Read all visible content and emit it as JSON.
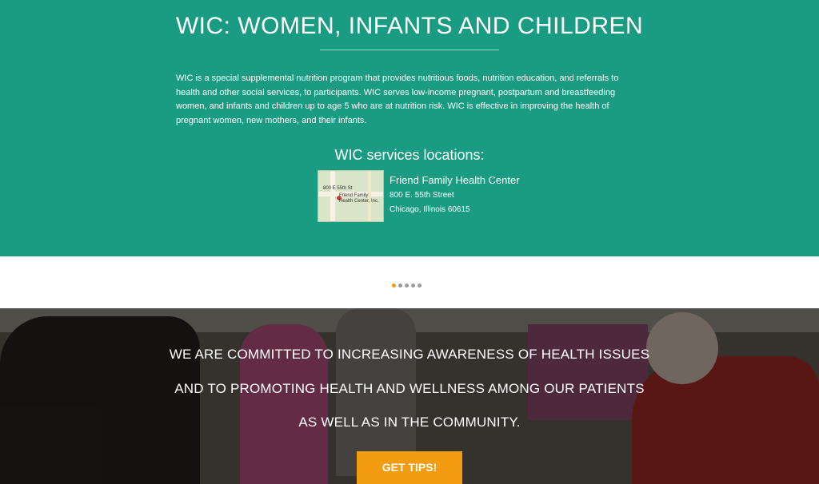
{
  "page": {
    "title": "WIC: WOMEN, INFANTS AND CHILDREN",
    "description": "WIC is a special supplemental nutrition program that provides nutritious foods, nutrition education, and referrals to health and other social services, to participants. WIC serves low-income pregnant, postpartum and breastfeeding women, and infants and children up to age 5 who are at nutrition risk. WIC is effective in improving the health of pregnant women, new mothers, and their infants.",
    "locations_title": "WIC services locations:"
  },
  "location": {
    "map_street": "800 E 55th St",
    "map_place": "Friend Family Health Center, Inc.",
    "name": "Friend Family Health Center",
    "address1": "800 E. 55th Street",
    "address2": "Chicago, Illinois 60615"
  },
  "carousel": {
    "total": 5,
    "active_index": 0
  },
  "hero": {
    "line1": "WE ARE COMMITTED TO INCREASING AWARENESS OF HEALTH ISSUES",
    "line2": "AND TO PROMOTING HEALTH AND WELLNESS AMONG OUR PATIENTS",
    "line3": "AS WELL AS IN THE COMMUNITY.",
    "button": "GET TIPS!"
  },
  "colors": {
    "teal": "#1a9c83",
    "accent": "#f39c12"
  }
}
